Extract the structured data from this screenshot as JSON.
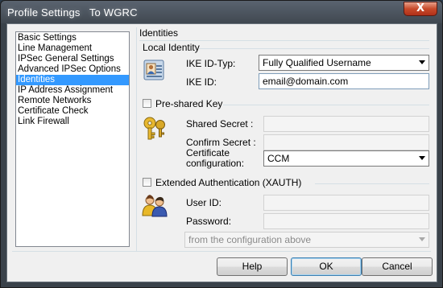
{
  "window": {
    "title": "Profile Settings   To WGRC",
    "close_label": "X"
  },
  "nav": {
    "items": [
      {
        "label": "Basic Settings"
      },
      {
        "label": "Line Management"
      },
      {
        "label": "IPSec General Settings"
      },
      {
        "label": "Advanced IPSec Options"
      },
      {
        "label": "Identities",
        "selected": true
      },
      {
        "label": "IP Address Assignment"
      },
      {
        "label": "Remote Networks"
      },
      {
        "label": "Certificate Check"
      },
      {
        "label": "Link Firewall"
      }
    ]
  },
  "identities": {
    "heading": "Identities",
    "local_identity": {
      "group_label": "Local Identity",
      "ike_id_type_label": "IKE ID-Typ:",
      "ike_id_type_value": "Fully Qualified Username",
      "ike_id_label": "IKE ID:",
      "ike_id_value": "email@domain.com"
    },
    "preshared": {
      "checkbox_label": "Pre-shared Key",
      "checked": false,
      "shared_secret_label": "Shared Secret :",
      "confirm_secret_label": "Confirm Secret :",
      "cert_config_label_line1": "Certificate",
      "cert_config_label_line2": "configuration:",
      "cert_config_value": "CCM"
    },
    "xauth": {
      "checkbox_label": "Extended Authentication (XAUTH)",
      "checked": false,
      "user_id_label": "User ID:",
      "password_label": "Password:",
      "source_value": "from the configuration above"
    }
  },
  "buttons": {
    "help": "Help",
    "ok": "OK",
    "cancel": "Cancel"
  },
  "icons": {
    "local_identity": "id-card-icon",
    "preshared": "keys-icon",
    "xauth": "users-icon"
  }
}
